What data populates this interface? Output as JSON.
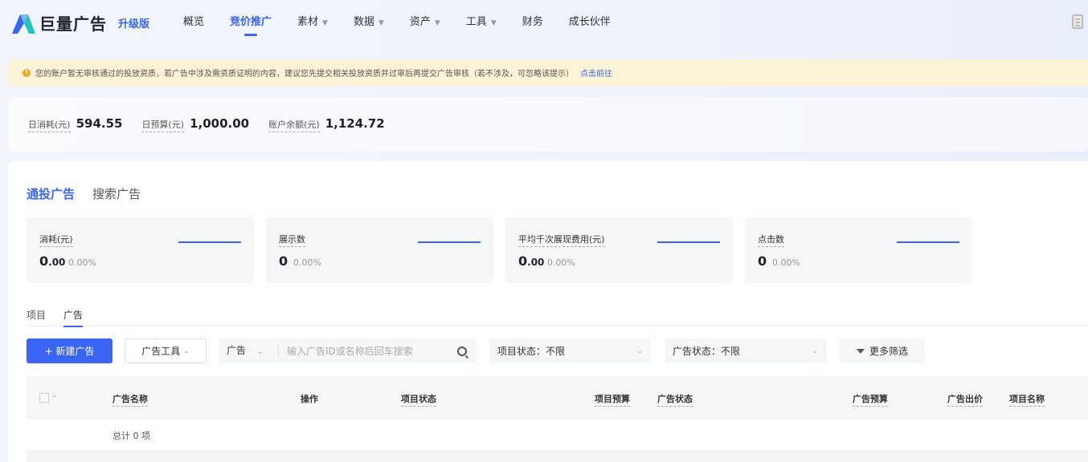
{
  "brand": {
    "name": "巨量广告",
    "badge": "升级版"
  },
  "nav": [
    {
      "label": "概览",
      "caret": false,
      "active": false
    },
    {
      "label": "竞价推广",
      "caret": false,
      "active": true
    },
    {
      "label": "素材",
      "caret": true,
      "active": false
    },
    {
      "label": "数据",
      "caret": true,
      "active": false
    },
    {
      "label": "资产",
      "caret": true,
      "active": false
    },
    {
      "label": "工具",
      "caret": true,
      "active": false
    },
    {
      "label": "财务",
      "caret": false,
      "active": false
    },
    {
      "label": "成长伙伴",
      "caret": false,
      "active": false
    }
  ],
  "notice": {
    "text": "您的账户暂无审核通过的投放资质，若广告中涉及需资质证明的内容，建议您先提交相关投放资质并过审后再提交广告审核（若不涉及，可忽略该提示）",
    "link": "点击前往"
  },
  "balance": [
    {
      "label": "日消耗(元)",
      "value": "594.55"
    },
    {
      "label": "日预算(元)",
      "value": "1,000.00"
    },
    {
      "label": "账户余额(元)",
      "value": "1,124.72"
    }
  ],
  "ad_type_tabs": [
    {
      "label": "通投广告",
      "active": true
    },
    {
      "label": "搜索广告",
      "active": false
    }
  ],
  "metrics": [
    {
      "label": "消耗(元)",
      "int": "0",
      "dec": ".00",
      "pct": "0.00%"
    },
    {
      "label": "展示数",
      "int": "0",
      "dec": "",
      "pct": "0.00%"
    },
    {
      "label": "平均千次展现费用(元)",
      "int": "0",
      "dec": ".00",
      "pct": "0.00%"
    },
    {
      "label": "点击数",
      "int": "0",
      "dec": "",
      "pct": "0.00%"
    }
  ],
  "sub_tabs": [
    {
      "label": "项目",
      "active": false
    },
    {
      "label": "广告",
      "active": true
    }
  ],
  "toolbar": {
    "new_button": "+ 新建广告",
    "ad_tools": "广告工具",
    "search_type": "广告",
    "search_placeholder": "输入广告ID或名称后回车搜索",
    "project_status": "项目状态：不限",
    "ad_status": "广告状态：不限",
    "more_filters": "更多筛选"
  },
  "table": {
    "columns": [
      "广告名称",
      "操作",
      "项目状态",
      "项目预算",
      "广告状态",
      "广告预算",
      "广告出价",
      "项目名称"
    ],
    "total": "总计 0 项"
  }
}
